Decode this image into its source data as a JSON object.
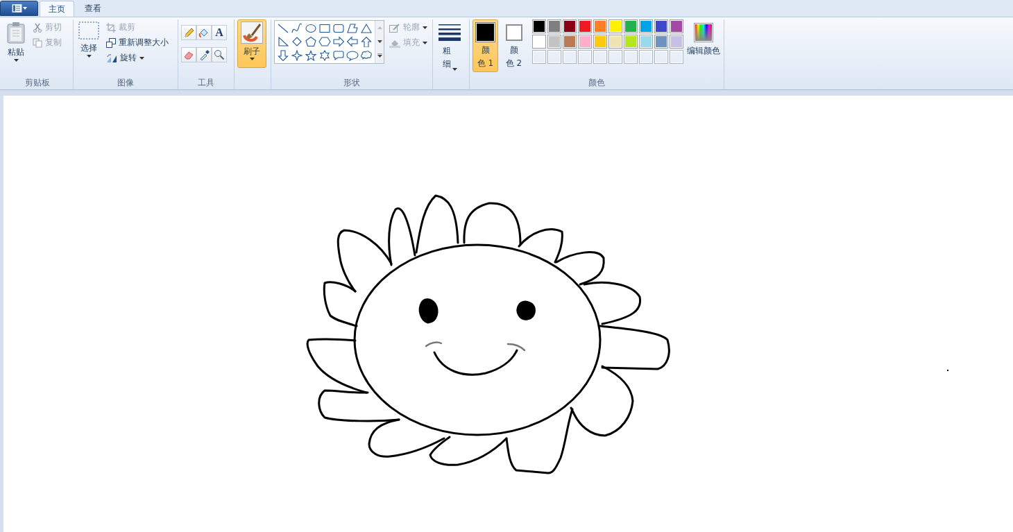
{
  "tabs": [
    {
      "label": "主页",
      "selected": true
    },
    {
      "label": "查看",
      "selected": false
    }
  ],
  "clipboard": {
    "paste_label": "粘贴",
    "cut": {
      "label": "剪切",
      "disabled": true
    },
    "copy": {
      "label": "复制",
      "disabled": true
    },
    "group_label": "剪贴板"
  },
  "image": {
    "select_label": "选择",
    "crop": {
      "label": "裁剪",
      "disabled": true
    },
    "resize": {
      "label": "重新调整大小",
      "disabled": false
    },
    "rotate": {
      "label": "旋转",
      "disabled": false
    },
    "group_label": "图像"
  },
  "tools": {
    "items": [
      {
        "kind": "pencil",
        "selected": false
      },
      {
        "kind": "fill",
        "selected": false
      },
      {
        "kind": "text",
        "selected": false,
        "glyph": "A"
      },
      {
        "kind": "eraser",
        "selected": false
      },
      {
        "kind": "picker",
        "selected": false
      },
      {
        "kind": "magnifier",
        "selected": false
      }
    ],
    "group_label": "工具"
  },
  "brushes": {
    "label": "刷子",
    "selected": true
  },
  "shapes": {
    "items": [
      {
        "kind": "line"
      },
      {
        "kind": "curve"
      },
      {
        "kind": "oval"
      },
      {
        "kind": "rectangle"
      },
      {
        "kind": "rounded-rectangle"
      },
      {
        "kind": "polygon"
      },
      {
        "kind": "triangle"
      },
      {
        "kind": "right-triangle"
      },
      {
        "kind": "diamond"
      },
      {
        "kind": "pentagon"
      },
      {
        "kind": "hexagon"
      },
      {
        "kind": "right-arrow"
      },
      {
        "kind": "left-arrow"
      },
      {
        "kind": "up-arrow"
      },
      {
        "kind": "down-arrow"
      },
      {
        "kind": "four-point-star"
      },
      {
        "kind": "five-point-star"
      },
      {
        "kind": "six-point-star"
      },
      {
        "kind": "rounded-callout"
      },
      {
        "kind": "oval-callout"
      },
      {
        "kind": "cloud-callout"
      }
    ],
    "outline": {
      "label": "轮廓",
      "disabled": true
    },
    "fill": {
      "label": "填充",
      "disabled": true
    },
    "group_label": "形状"
  },
  "size": {
    "label": "粗细"
  },
  "colors": {
    "color_1": {
      "label": "颜色 1",
      "color": "#000000",
      "selected": true
    },
    "color_2": {
      "label": "颜色 2",
      "color": "#ffffff",
      "selected": false
    },
    "palette": [
      {
        "color": "#000000"
      },
      {
        "color": "#7f7f7f"
      },
      {
        "color": "#880015"
      },
      {
        "color": "#ed1c24"
      },
      {
        "color": "#ff7f27"
      },
      {
        "color": "#fff200"
      },
      {
        "color": "#22b14c"
      },
      {
        "color": "#00a2e8"
      },
      {
        "color": "#3f48cc"
      },
      {
        "color": "#a349a4"
      },
      {
        "color": "#ffffff"
      },
      {
        "color": "#c3c3c3"
      },
      {
        "color": "#b97a57"
      },
      {
        "color": "#ffaec9"
      },
      {
        "color": "#ffc90e"
      },
      {
        "color": "#efe4b0"
      },
      {
        "color": "#b5e61d"
      },
      {
        "color": "#99d9ea"
      },
      {
        "color": "#7092be"
      },
      {
        "color": "#c8bfe7"
      }
    ],
    "edit_label": "编辑颜色",
    "group_label": "颜色"
  }
}
